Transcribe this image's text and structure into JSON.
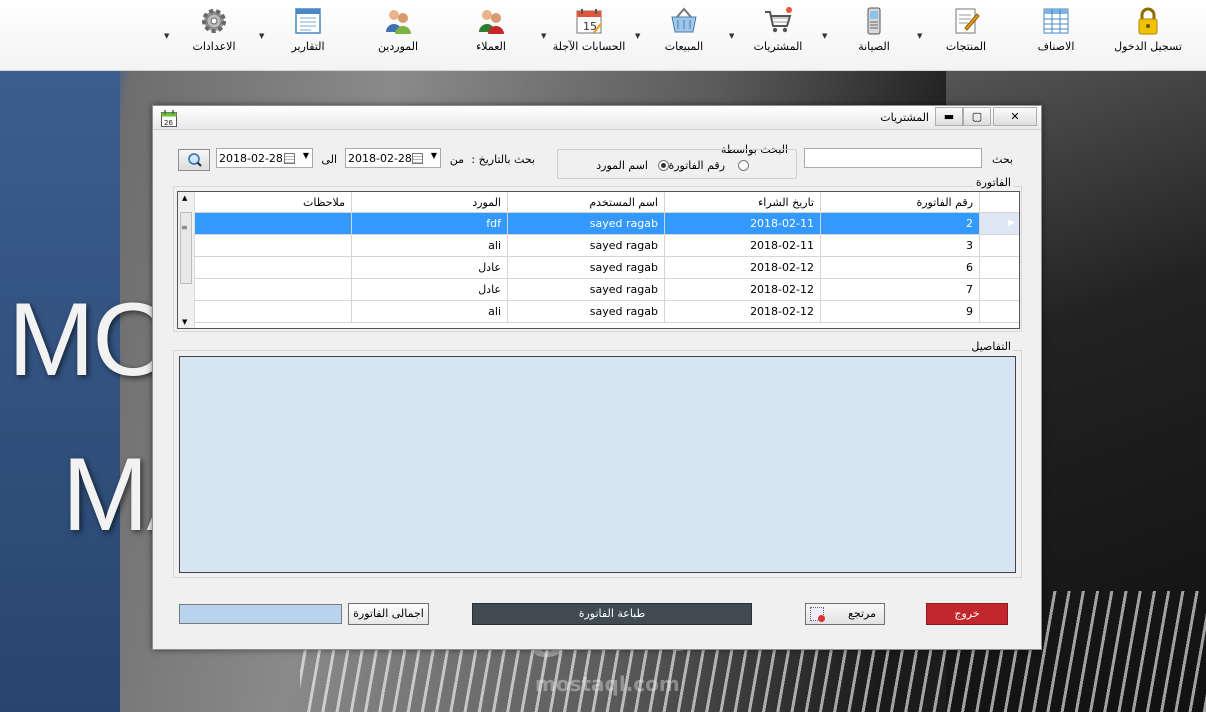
{
  "ribbon": {
    "items": [
      {
        "label": "تسجيل الدخول",
        "icon": "lock-icon"
      },
      {
        "label": "الاصناف",
        "icon": "spreadsheet-icon"
      },
      {
        "label": "المنتجات",
        "icon": "notepad-icon"
      },
      {
        "label": "الصيانة",
        "icon": "mobile-phone-icon"
      },
      {
        "label": "المشتريات",
        "icon": "shopping-cart-icon"
      },
      {
        "label": "المبيعات",
        "icon": "basket-icon"
      },
      {
        "label": "الحسابات الآجلة",
        "icon": "calendar-icon",
        "date_number": "15"
      },
      {
        "label": "العملاء",
        "icon": "customers-icon"
      },
      {
        "label": "الموردين",
        "icon": "suppliers-icon"
      },
      {
        "label": "التقارير",
        "icon": "report-icon"
      },
      {
        "label": "الاعدادات",
        "icon": "gear-icon"
      }
    ]
  },
  "background": {
    "line1": "MOB",
    "line2": "MA",
    "watermark": "مستقل",
    "watermark_url": "mostaql.com"
  },
  "window": {
    "title": "المشتريات",
    "app_icon_number": "26",
    "controls": {
      "minimize": "▬",
      "maximize": "▢",
      "close": "✕"
    }
  },
  "search": {
    "label": "بحث",
    "value": "",
    "search_by_label": "البحث بواسطة",
    "radio_invoice": "رقم الفاتورة",
    "radio_supplier": "اسم المورد",
    "selected": "supplier",
    "date_label": "بحث بالتاريخ :",
    "from_label": "من",
    "to_label": "الى",
    "from_date": "2018-02-28",
    "to_date": "2018-02-28"
  },
  "invoice_section": {
    "legend": "الفاتورة",
    "columns": [
      "رقم الفاتورة",
      "تاريخ الشراء",
      "اسم المستخدم",
      "المورد",
      "ملاحظات"
    ],
    "rows": [
      {
        "invoice_no": "2",
        "date": "2018-02-11",
        "user": "sayed ragab",
        "supplier": "fdf",
        "notes": "",
        "selected": true
      },
      {
        "invoice_no": "3",
        "date": "2018-02-11",
        "user": "sayed ragab",
        "supplier": "ali",
        "notes": "",
        "selected": false
      },
      {
        "invoice_no": "6",
        "date": "2018-02-12",
        "user": "sayed ragab",
        "supplier": "عادل",
        "notes": "",
        "selected": false
      },
      {
        "invoice_no": "7",
        "date": "2018-02-12",
        "user": "sayed ragab",
        "supplier": "عادل",
        "notes": "",
        "selected": false
      },
      {
        "invoice_no": "9",
        "date": "2018-02-12",
        "user": "sayed ragab",
        "supplier": "ali",
        "notes": "",
        "selected": false
      }
    ]
  },
  "details_section": {
    "legend": "التفاصيل"
  },
  "footer": {
    "exit_label": "خروج",
    "return_label": "مرتجع",
    "print_label": "طباعة الفاتورة",
    "total_label": "اجمالى الفاتورة",
    "total_value": ""
  },
  "colors": {
    "selected_row": "#3399ff",
    "exit_button": "#c1272d",
    "print_button": "#3f4a52",
    "details_bg": "#d7e4f1"
  }
}
